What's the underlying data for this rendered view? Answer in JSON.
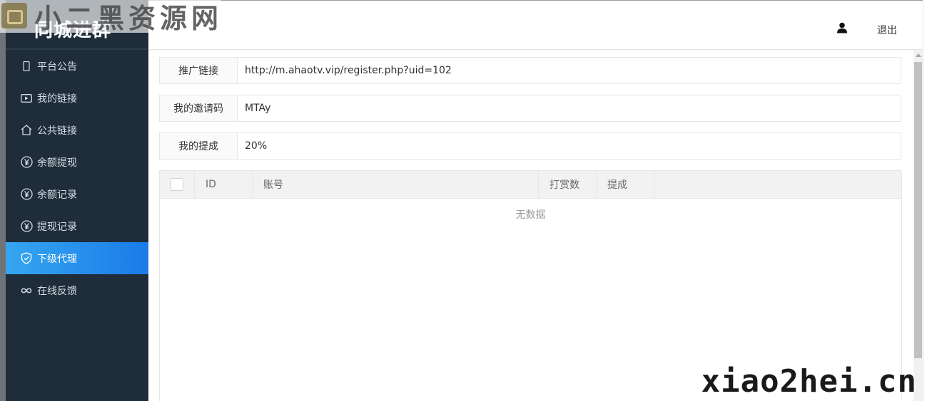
{
  "sidebar": {
    "logo": "同城进群",
    "items": [
      {
        "label": "平台公告",
        "icon": "mobile-icon",
        "active": false
      },
      {
        "label": "我的链接",
        "icon": "video-icon",
        "active": false
      },
      {
        "label": "公共链接",
        "icon": "home-icon",
        "active": false
      },
      {
        "label": "余额提现",
        "icon": "yen-icon",
        "active": false
      },
      {
        "label": "余额记录",
        "icon": "yen-icon",
        "active": false
      },
      {
        "label": "提现记录",
        "icon": "yen-icon",
        "active": false
      },
      {
        "label": "下级代理",
        "icon": "shield-check-icon",
        "active": true
      },
      {
        "label": "在线反馈",
        "icon": "infinity-icon",
        "active": false
      }
    ]
  },
  "header": {
    "user_icon": "user-icon",
    "logout_label": "退出"
  },
  "fields": {
    "promo_link": {
      "label": "推广链接",
      "value": "http://m.ahaotv.vip/register.php?uid=102"
    },
    "invite_code": {
      "label": "我的邀请码",
      "value": "MTAy"
    },
    "commission": {
      "label": "我的提成",
      "value": "20%"
    }
  },
  "table": {
    "columns": [
      "ID",
      "账号",
      "打赏数",
      "提成"
    ],
    "empty_text": "无数据"
  },
  "watermarks": {
    "top": "小二黑资源网",
    "bottom": "xiao2hei.cn"
  },
  "colors": {
    "sidebar_bg": "#1f2c3a",
    "active_gradient_start": "#35a6f0",
    "active_gradient_end": "#1a7be8"
  }
}
